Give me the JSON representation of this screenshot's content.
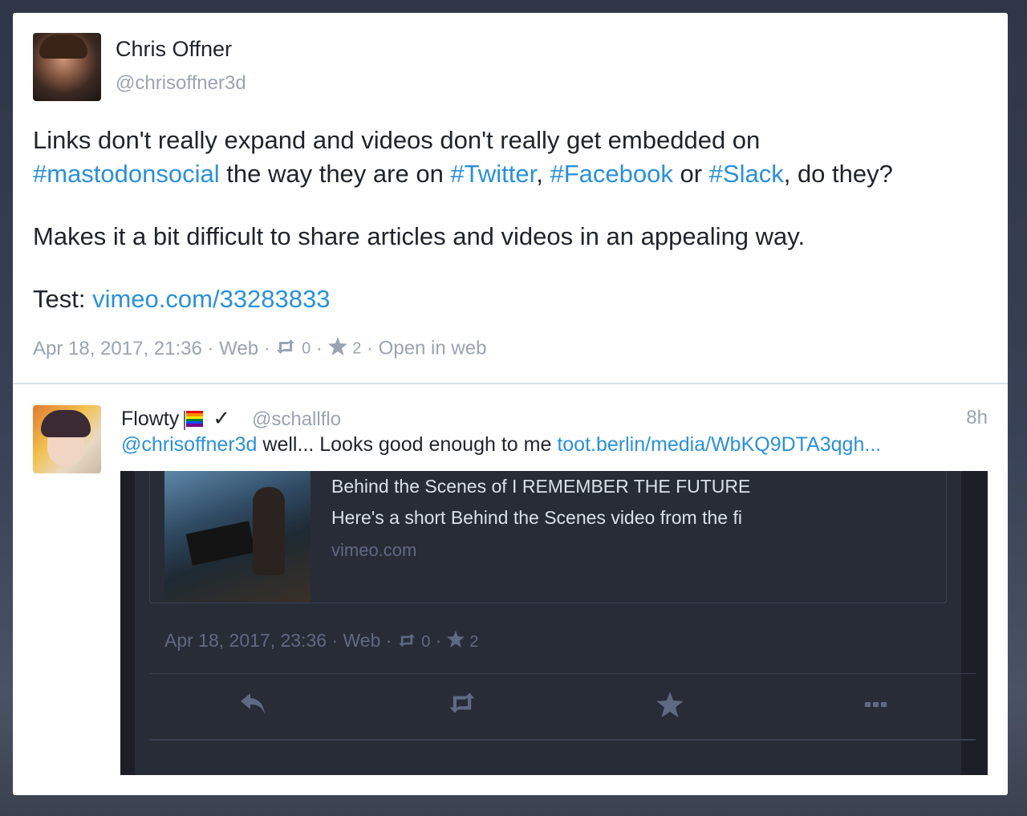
{
  "status": {
    "author": {
      "display_name": "Chris Offner",
      "handle": "@chrisoffner3d"
    },
    "content": {
      "p1_text_1": "Links don't really expand and videos don't really get embedded on",
      "p1_tag_mastodon": "#mastodonsocial",
      "p1_text_2": " the way they are on ",
      "p1_tag_twitter": "#Twitter",
      "p1_text_3": ", ",
      "p1_tag_facebook": "#Facebook",
      "p1_text_4": " or ",
      "p1_tag_slack": "#Slack",
      "p1_text_5": ", do they?",
      "p2": "Makes it a bit difficult to share articles and videos in an appealing way.",
      "p3_label": "Test: ",
      "p3_link": "vimeo.com/33283833"
    },
    "meta": {
      "date": "Apr 18, 2017, 21:36",
      "sep": " · ",
      "application": "Web",
      "reblogs": "0",
      "favourites": "2",
      "open_in_web": "Open in web"
    }
  },
  "reply": {
    "display_name": "Flowty",
    "verified_mark": "✓",
    "handle": "@schallflo",
    "relative_time": "8h",
    "mention": "@chrisoffner3d",
    "text": " well... Looks good  enough to me ",
    "link": "toot.berlin/media/WbKQ9DTA3qgh..."
  },
  "embedded_screenshot": {
    "card_title": "Behind the Scenes of I REMEMBER THE FUTURE",
    "card_description": "Here's a short Behind the Scenes video from the fi",
    "card_domain": "vimeo.com",
    "date": "Apr 18, 2017, 23:36",
    "application": "Web",
    "reblogs": "0",
    "favourites": "2"
  },
  "icons": {
    "reblog": "retweet-icon",
    "favourite": "star-icon",
    "reply": "reply-icon",
    "more": "ellipsis-icon"
  },
  "colors": {
    "link": "#2b90d9",
    "muted": "#9aa3b2",
    "dark_bg": "#282c37"
  }
}
